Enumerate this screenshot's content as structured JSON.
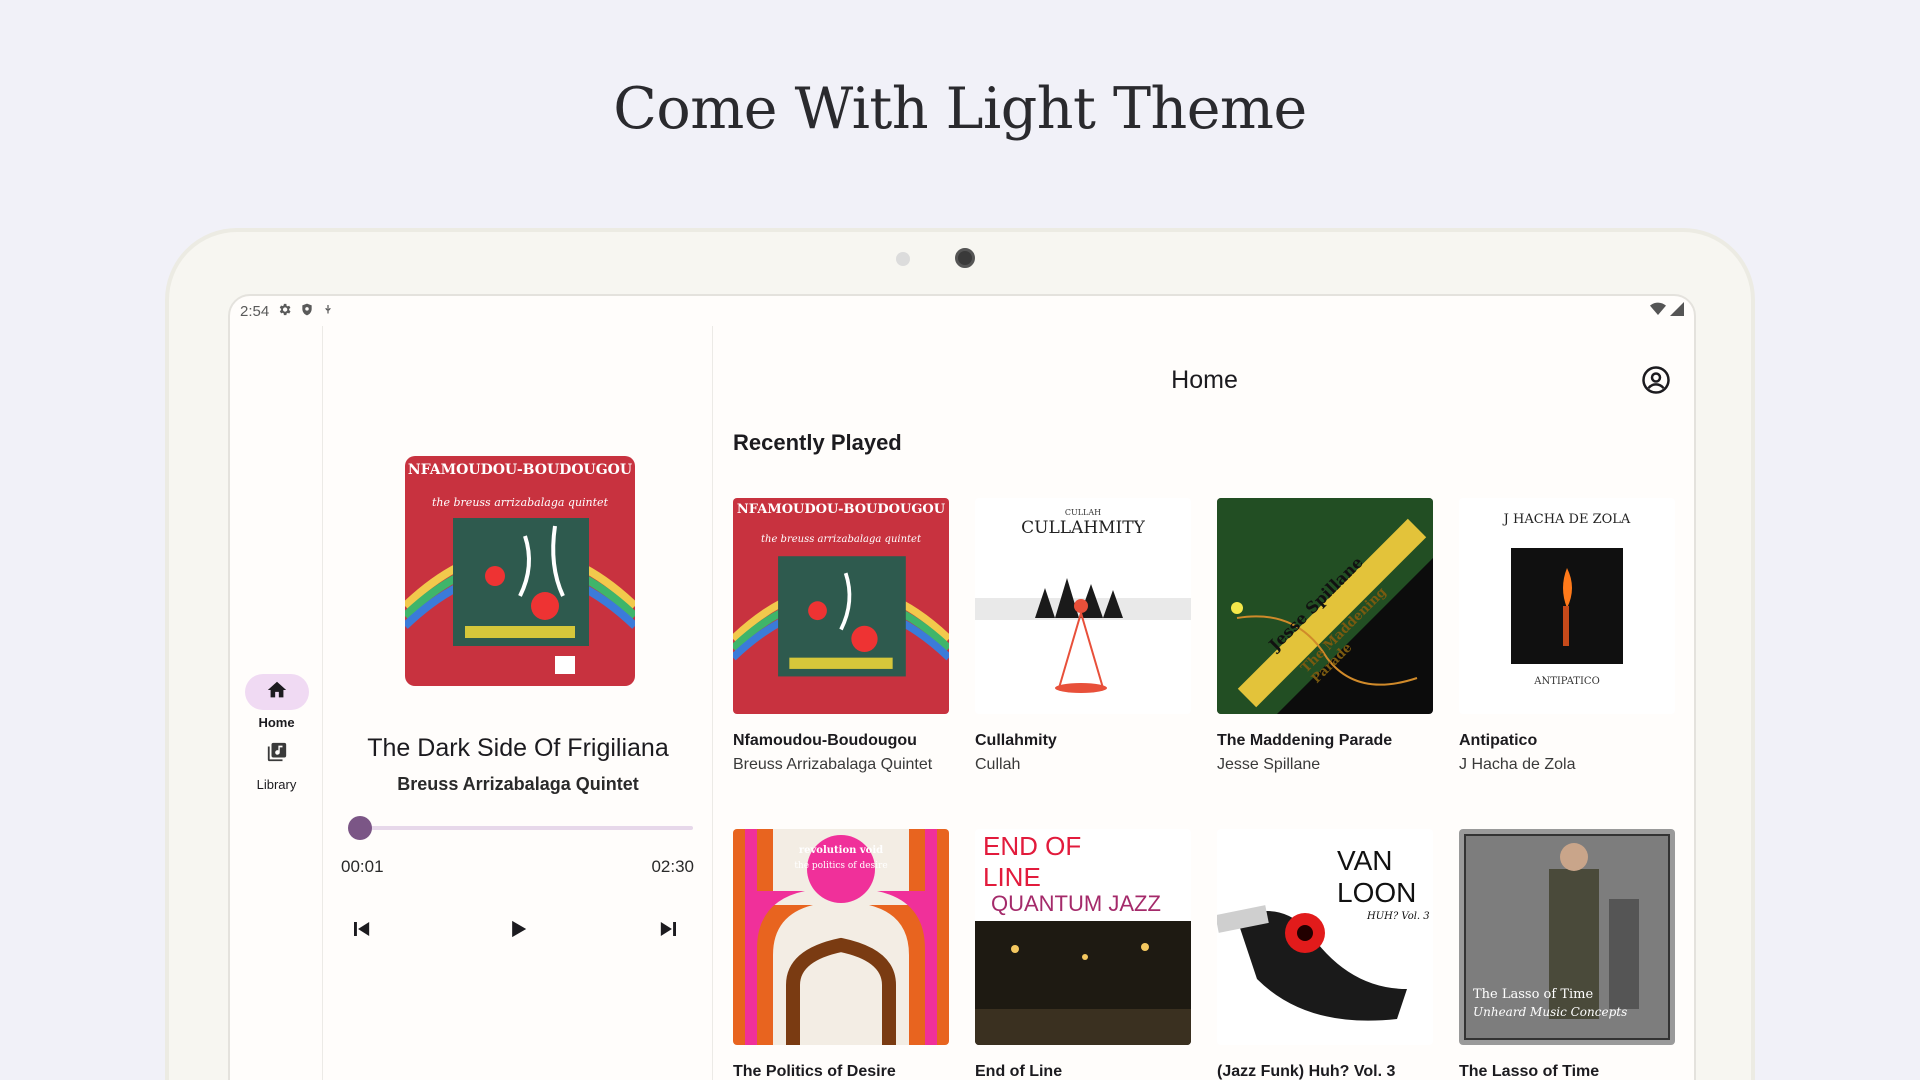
{
  "headline": "Come With Light Theme",
  "status_bar": {
    "time": "2:54",
    "left_icons": [
      "gear-icon",
      "shield-icon",
      "mic-icon"
    ],
    "right_icons": [
      "wifi-icon",
      "signal-icon"
    ]
  },
  "rail": {
    "items": [
      {
        "label": "Home",
        "icon": "home-icon",
        "active": true
      },
      {
        "label": "Library",
        "icon": "library-icon",
        "active": false
      }
    ]
  },
  "player": {
    "title": "The Dark Side Of Frigiliana",
    "artist": "Breuss Arrizabalaga Quintet",
    "current_time": "00:01",
    "total_time": "02:30",
    "progress": 0.01,
    "art": {
      "line1": "NFAMOUDOU-BOUDOUGOU",
      "line2": "the breuss arrizabalaga quintet"
    }
  },
  "main": {
    "title": "Home",
    "section_title": "Recently Played",
    "albums": [
      {
        "title": "Nfamoudou-Boudougou",
        "artist": "Breuss Arrizabalaga Quintet",
        "art_text": "NFAMOUDOU-BOUDOUGOU",
        "art_sub": "the breuss arrizabalaga quintet"
      },
      {
        "title": "Cullahmity",
        "artist": "Cullah",
        "art_text": "CULLAHMITY",
        "art_sub": "CULLAH"
      },
      {
        "title": "The Maddening Parade",
        "artist": "Jesse Spillane",
        "art_text": "Jesse Spillane",
        "art_sub": "The Maddening Parade"
      },
      {
        "title": "Antipatico",
        "artist": "J Hacha de Zola",
        "art_text": "J HACHA DE ZOLA",
        "art_sub": "ANTIPATICO"
      },
      {
        "title": "The Politics of Desire",
        "artist": "",
        "art_text": "revolution void",
        "art_sub": "the politics of desire"
      },
      {
        "title": "End of Line",
        "artist": "",
        "art_text": "END OF LINE",
        "art_sub": "QUANTUM JAZZ"
      },
      {
        "title": "(Jazz Funk) Huh? Vol. 3",
        "artist": "",
        "art_text": "VAN LOON",
        "art_sub": "HUH? Vol. 3"
      },
      {
        "title": "The Lasso of Time",
        "artist": "",
        "art_text": "The Lasso of Time",
        "art_sub": "Unheard Music Concepts"
      }
    ]
  },
  "colors": {
    "accent": "#7b5686",
    "accent_container": "#f0daf3",
    "background": "#f1f1f8",
    "surface": "#fffdfb"
  }
}
